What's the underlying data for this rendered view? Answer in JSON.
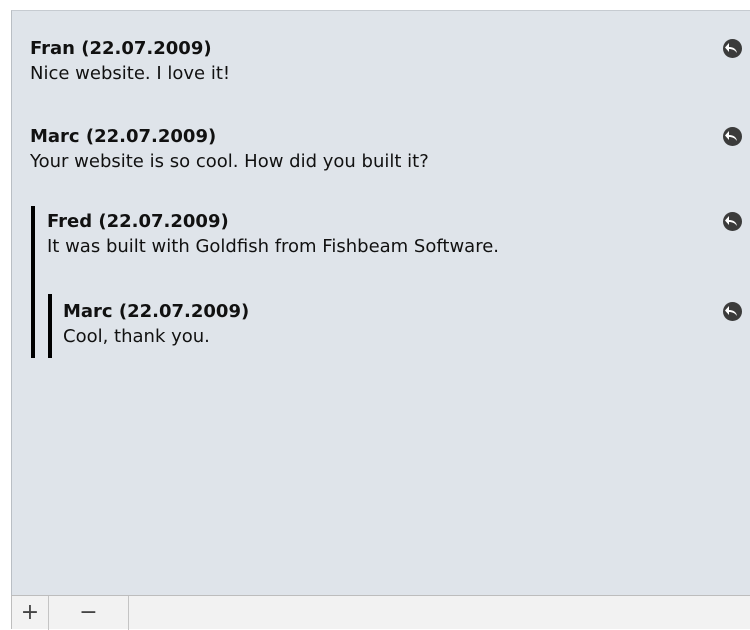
{
  "comments": [
    {
      "author": "Fran (22.07.2009)",
      "text": "Nice website. I love it!",
      "level": 0
    },
    {
      "author": "Marc (22.07.2009)",
      "text": "Your website is so cool. How did you built it?",
      "level": 0
    },
    {
      "author": "Fred (22.07.2009)",
      "text": "It was built with Goldfish from Fishbeam Software.",
      "level": 1
    },
    {
      "author": "Marc (22.07.2009)",
      "text": "Cool, thank you.",
      "level": 2
    }
  ],
  "toolbar": {
    "add_label": "+",
    "remove_label": "−"
  },
  "icons": {
    "reply": "reply-arrow-icon"
  },
  "colors": {
    "panel_background": "#dfe4ea",
    "thread_bar": "#000000",
    "icon": "#3b3b3b"
  }
}
